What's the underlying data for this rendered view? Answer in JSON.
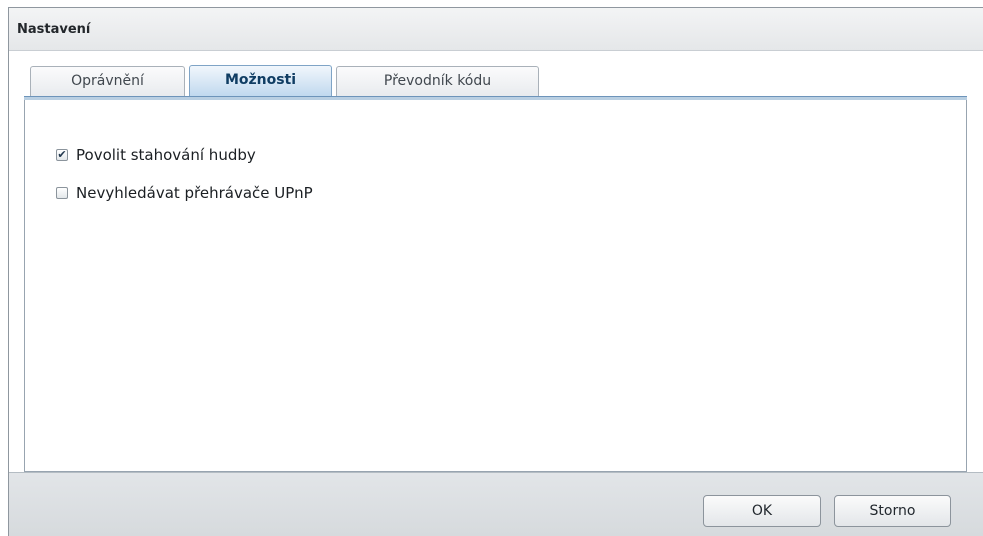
{
  "window": {
    "title": "Nastavení"
  },
  "tabs": [
    {
      "label": "Oprávnění",
      "active": false
    },
    {
      "label": "Možnosti",
      "active": true
    },
    {
      "label": "Převodník kódu",
      "active": false
    }
  ],
  "options": [
    {
      "label": "Povolit stahování hudby",
      "checked": true,
      "check_glyph": "✔"
    },
    {
      "label": "Nevyhledávat přehrávače UPnP",
      "checked": false,
      "check_glyph": ""
    }
  ],
  "buttons": {
    "ok_label": "OK",
    "cancel_label": "Storno"
  },
  "colors": {
    "active_tab": "#bfd8ee",
    "tab_border": "#6d94ba",
    "footer": "#d6dadd"
  }
}
